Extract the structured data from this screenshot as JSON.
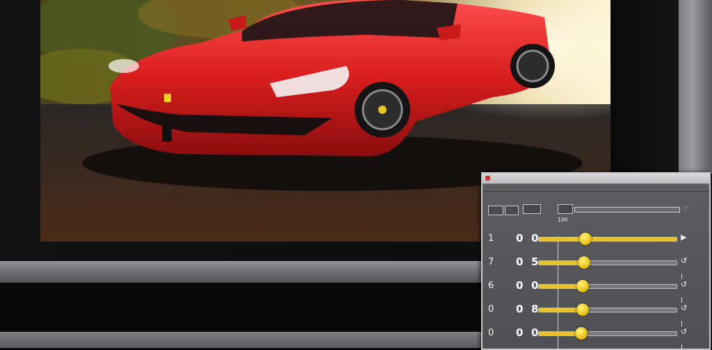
{
  "panel": {
    "title": "",
    "menu": [
      "",
      "",
      ""
    ],
    "toolbar": {
      "label_left": "",
      "label_mid": "100",
      "top_right": "",
      "preset_icon": "heart-icon"
    },
    "rows": [
      {
        "index": "1",
        "val_a": "0",
        "val_b": "0",
        "level": 0.34,
        "end_icon": "play-icon",
        "active": true
      },
      {
        "index": "7",
        "val_a": "0",
        "val_b": "5",
        "level": 0.33,
        "end_icon": "reset-icon",
        "active": false
      },
      {
        "index": "6",
        "val_a": "0",
        "val_b": "0",
        "level": 0.32,
        "end_icon": "reset-icon",
        "active": false
      },
      {
        "index": "0",
        "val_a": "0",
        "val_b": "8",
        "level": 0.32,
        "end_icon": "reset-icon",
        "active": false
      },
      {
        "index": "0",
        "val_a": "0",
        "val_b": "0",
        "level": 0.31,
        "end_icon": "reset-icon",
        "active": false
      }
    ]
  },
  "colors": {
    "accent": "#e8c22a",
    "car_red": "#d81d1d",
    "panel_bg": "#5c5e61"
  }
}
